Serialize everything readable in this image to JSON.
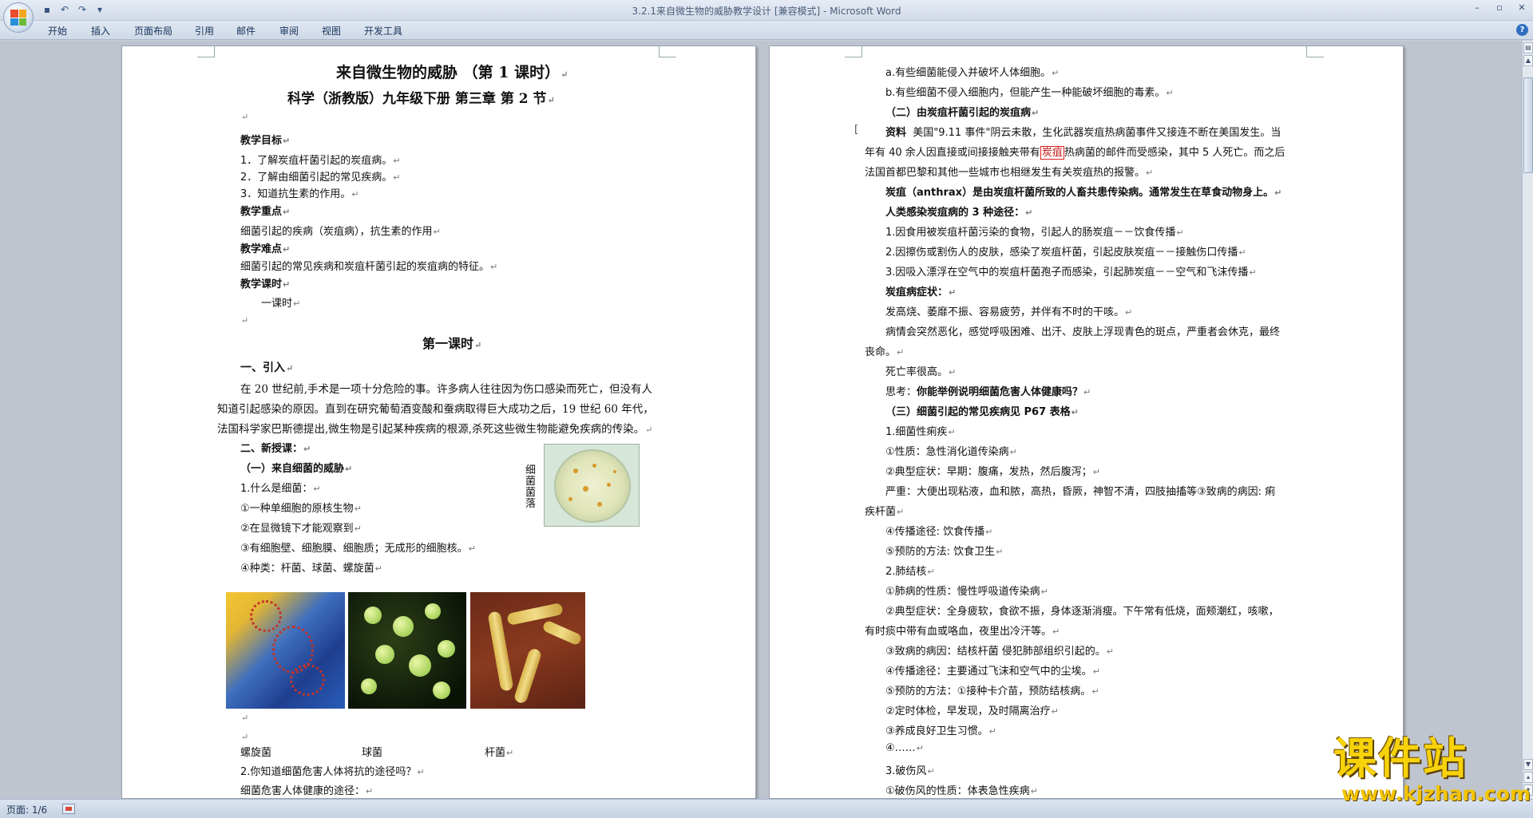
{
  "window": {
    "title": "3.2.1来自微生物的威胁教学设计 [兼容模式] - Microsoft Word",
    "controls": [
      "–",
      "▫",
      "✕"
    ]
  },
  "quick_access": [
    "save-icon",
    "undo-icon",
    "redo-icon",
    "customize-icon"
  ],
  "ribbon": {
    "tabs": [
      "开始",
      "插入",
      "页面布局",
      "引用",
      "邮件",
      "审阅",
      "视图",
      "开发工具"
    ]
  },
  "status": {
    "page": "页面: 1/6"
  },
  "left_page": {
    "title": "来自微生物的威胁 （第 1 课时）",
    "subtitle": "科学（浙教版）九年级下册  第三章  第 2 节",
    "goals_heading": "教学目标",
    "goals": [
      "1．了解炭疽杆菌引起的炭疽病。",
      "2．了解由细菌引起的常见疾病。",
      "3．知道抗生素的作用。"
    ],
    "focus_heading": "教学重点",
    "focus_text": "细菌引起的疾病（炭疽病），抗生素的作用",
    "difficulty_heading": "教学难点",
    "difficulty_text": "细菌引起的常见疾病和炭疽杆菌引起的炭疽病的特征。",
    "hours_heading": "教学课时",
    "hours_text": "一课时",
    "lesson_heading": "第一课时",
    "intro_heading": "一、引入",
    "intro_para": [
      "在 20 世纪前,手术是一项十分危险的事。许多病人往往因为伤口感染而死亡，但没有人",
      "知道引起感染的原因。直到在研究葡萄酒变酸和蚕病取得巨大成功之后，19 世纪 60 年代，",
      "法国科学家巴斯德提出,微生物是引起某种疾病的根源,杀死这些微生物能避免疾病的传染。"
    ],
    "new_heading": "二、新授课：",
    "sub1_heading": "（一）来自细菌的威胁",
    "q1": "1.什么是细菌：",
    "points": [
      "①一种单细胞的原核生物",
      "②在显微镜下才能观察到",
      "③有细胞壁、细胞膜、细胞质；无成形的细胞核。",
      "④种类：杆菌、球菌、螺旋菌"
    ],
    "petri_caption": "细菌菌落",
    "captions": [
      "螺旋菌",
      "球菌",
      "杆菌"
    ],
    "q2": "2.你知道细菌危害人体将抗的途径吗？",
    "q2_text": "细菌危害人体健康的途径："
  },
  "right_page": {
    "lines_a": [
      "a.有些细菌能侵入并破坏人体细胞。",
      "b.有些细菌不侵入细胞内，但能产生一种能破坏细胞的毒素。"
    ],
    "sub2_heading": "（二）由炭疽杆菌引起的炭疽病",
    "material_label": "资料",
    "material_1": "美国\"9.11 事件\"阴云未散，生化武器炭疽热病菌事件又接连不断在美国发生。当",
    "material_2a": "年有 40 余人因直接或间接接触夹带有",
    "material_2_hl": "炭疽",
    "material_2b": "热病菌的邮件而受感染，其中 5 人死亡。而之后",
    "material_3": "法国首都巴黎和其他一些城市也相继发生有关炭疽热的报警。",
    "anthrax_def": "炭疽（anthrax）是由炭疽杆菌所致的人畜共患传染病。通常发生在草食动物身上。",
    "routes_heading": "人类感染炭疽病的 3 种途径：",
    "routes": [
      "1.因食用被炭疽杆菌污染的食物，引起人的肠炭疽－－饮食传播",
      "2.因擦伤或割伤人的皮肤，感染了炭疽杆菌，引起皮肤炭疽－－接触伤口传播",
      "3.因吸入漂浮在空气中的炭疽杆菌孢子而感染，引起肺炭疽－－空气和飞沫传播"
    ],
    "symptoms_heading": "炭疽病症状：",
    "symptom_1": "发高烧、萎靡不振、容易疲劳，并伴有不时的干咳。",
    "symptom_2a": "病情会突然恶化，感觉呼吸困难、出汗、皮肤上浮现青色的斑点，严重者会休克，最终",
    "symptom_2b": "丧命。",
    "symptom_3": "死亡率很高。",
    "think_label": "思考：",
    "think_text": "你能举例说明细菌危害人体健康吗？",
    "sub3_heading": "（三）细菌引起的常见疾病见 P67 表格",
    "dysentery": [
      "1.细菌性痢疾",
      "①性质：急性消化道传染病",
      "②典型症状：早期：腹痛，发热，然后腹泻；",
      "严重：大便出现粘液，血和脓，高热，昏厥，神智不清，四肢抽搐等③致病的病因: 痢",
      "疾杆菌",
      "④传播途径: 饮食传播",
      "⑤预防的方法: 饮食卫生"
    ],
    "tb": [
      "2.肺结核",
      "①肺病的性质：慢性呼吸道传染病",
      "②典型症状：全身疲软，食欲不振，身体逐渐消瘦。下午常有低烧，面颊潮红，咳嗽，",
      "有时痰中带有血或咯血，夜里出冷汗等。",
      "③致病的病因：结核杆菌   侵犯肺部组织引起的。",
      "④传播途径：主要通过飞沫和空气中的尘埃。",
      "⑤预防的方法：①接种卡介苗，预防结核病。",
      "②定时体检，早发现，及时隔离治疗",
      "③养成良好卫生习惯。",
      "④……"
    ],
    "tetanus": [
      "3.破伤风",
      "①破伤风的性质：体表急性疾病"
    ]
  },
  "watermark": {
    "title": "课件站",
    "url": "www.kjzhan.com"
  }
}
